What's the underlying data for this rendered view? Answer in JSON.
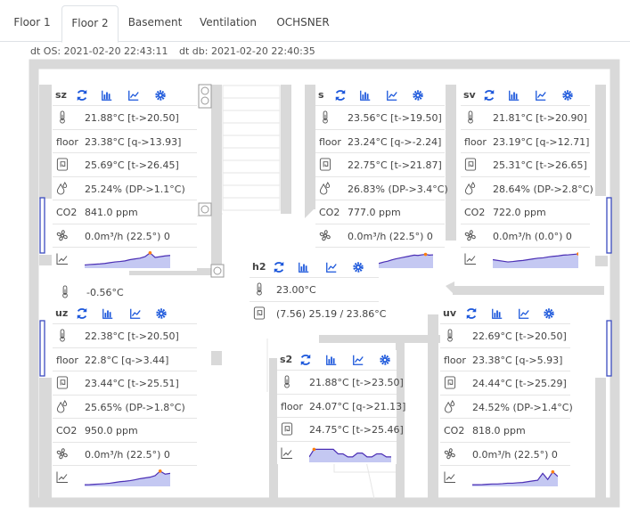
{
  "tabs": [
    {
      "label": "Floor 1",
      "active": false
    },
    {
      "label": "Floor 2",
      "active": true
    },
    {
      "label": "Basement",
      "active": false
    },
    {
      "label": "Ventilation",
      "active": false
    },
    {
      "label": "OCHSNER",
      "active": false
    }
  ],
  "dt_os": "dt OS: 2021-02-20 22:43:11",
  "dt_db": "dt db: 2021-02-20 22:40:35",
  "colors": {
    "accent": "#1a56db",
    "wall": "#d9d9d9",
    "window": "#3b4cc0",
    "spark_line": "#4b2fb5",
    "spark_fill": "#c4c8f2",
    "spark_dot": "#ff7f0e"
  },
  "row_icons": {
    "thermometer": "thermometer-icon",
    "floor": "floor-text",
    "heating": "radiator-icon",
    "humidity": "drops-icon",
    "co2": "co2-text",
    "fan": "fan-icon",
    "chart": "chart-icon"
  },
  "rooms": {
    "sz": {
      "name": "sz",
      "temp": "21.88°C [t->20.50]",
      "floor_label": "floor",
      "floor": "23.38°C [q->13.93]",
      "heating": "25.69°C [t->26.45]",
      "humidity": "25.24% (DP->1.1°C)",
      "co2_label": "CO2",
      "co2": "841.0 ppm",
      "fan": "0.0m³/h (22.5°) 0",
      "spark": [
        0.15,
        0.18,
        0.2,
        0.22,
        0.25,
        0.3,
        0.35,
        0.38,
        0.42,
        0.5,
        0.55,
        0.6,
        0.7,
        0.95,
        0.65,
        0.7,
        0.75,
        0.78
      ]
    },
    "s": {
      "name": "s",
      "temp": "23.56°C [t->19.50]",
      "floor_label": "floor",
      "floor": "23.24°C [q->-2.24]",
      "heating": "22.75°C [t->21.87]",
      "humidity": "26.83% (DP->3.4°C)",
      "co2_label": "CO2",
      "co2": "777.0 ppm",
      "fan": "0.0m³/h (22.5°) 0",
      "spark": [
        0.1,
        0.15,
        0.2,
        0.28,
        0.35,
        0.4,
        0.48,
        0.55,
        0.6,
        0.65,
        0.7,
        0.75,
        0.8,
        0.78,
        0.82,
        0.85,
        0.8,
        0.82
      ]
    },
    "sv": {
      "name": "sv",
      "temp": "21.81°C [t->20.90]",
      "floor_label": "floor",
      "floor": "23.19°C [q->12.71]",
      "heating": "25.31°C [t->26.65]",
      "humidity": "28.64% (DP->2.8°C)",
      "co2_label": "CO2",
      "co2": "722.0 ppm",
      "fan": "0.0m³/h (0.0°) 0",
      "spark": [
        0.5,
        0.45,
        0.4,
        0.35,
        0.38,
        0.42,
        0.45,
        0.5,
        0.55,
        0.6,
        0.62,
        0.68,
        0.72,
        0.75,
        0.8,
        0.82,
        0.85,
        0.88
      ]
    },
    "h2": {
      "name": "h2",
      "temp": "23.00°C",
      "heating": "(7.56) 25.19 / 23.86°C"
    },
    "corridor": {
      "temp": "-0.56°C"
    },
    "uz": {
      "name": "uz",
      "temp": "22.38°C [t->20.50]",
      "floor_label": "floor",
      "floor": "22.8°C [q->3.44]",
      "heating": "23.44°C [t->25.51]",
      "humidity": "25.65% (DP->1.8°C)",
      "co2_label": "CO2",
      "co2": "950.0 ppm",
      "fan": "0.0m³/h (22.5°) 0",
      "spark": [
        0.05,
        0.06,
        0.08,
        0.1,
        0.12,
        0.15,
        0.2,
        0.25,
        0.28,
        0.32,
        0.38,
        0.45,
        0.5,
        0.55,
        0.65,
        0.95,
        0.75,
        0.8
      ]
    },
    "s2": {
      "name": "s2",
      "temp": "21.88°C [t->23.50]",
      "floor_label": "floor",
      "floor": "24.07°C [q->21.13]",
      "heating": "24.75°C [t->25.46]",
      "spark": [
        0.3,
        0.8,
        0.8,
        0.8,
        0.8,
        0.8,
        0.5,
        0.5,
        0.3,
        0.3,
        0.55,
        0.55,
        0.3,
        0.3,
        0.5,
        0.5,
        0.3,
        0.3
      ]
    },
    "uv": {
      "name": "uv",
      "temp": "22.69°C [t->20.50]",
      "floor_label": "floor",
      "floor": "23.38°C [q->5.93]",
      "heating": "24.44°C [t->25.29]",
      "humidity": "24.52% (DP->1.4°C)",
      "co2_label": "CO2",
      "co2": "818.0 ppm",
      "fan": "0.0m³/h (22.5°) 0",
      "spark": [
        0.05,
        0.05,
        0.06,
        0.08,
        0.1,
        0.1,
        0.12,
        0.15,
        0.15,
        0.18,
        0.2,
        0.25,
        0.3,
        0.35,
        0.8,
        0.4,
        0.9,
        0.6
      ]
    }
  }
}
